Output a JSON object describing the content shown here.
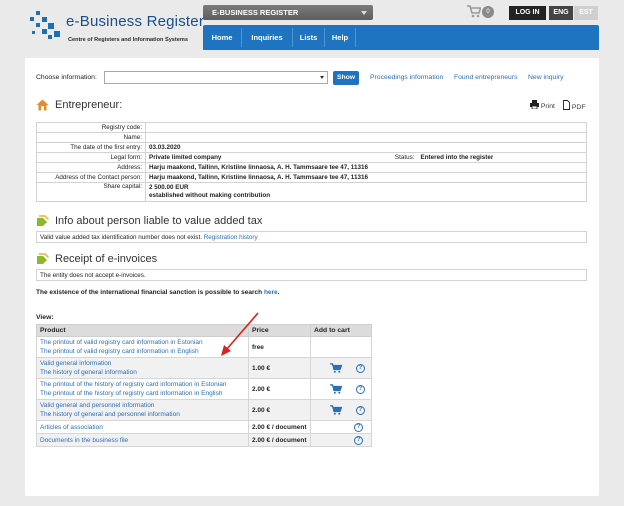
{
  "header": {
    "logo_title": "e-Business Register",
    "logo_subtitle": "Centre of Registers and Information Systems",
    "register_select": "E-BUSINESS REGISTER",
    "cart_count": "0",
    "login_label": "LOG IN",
    "lang_eng": "ENG",
    "lang_est": "EST"
  },
  "nav": [
    "Home",
    "Inquiries",
    "Lists",
    "Help"
  ],
  "search": {
    "choose_label": "Choose information:",
    "select_value": "",
    "show_label": "Show",
    "links": [
      "Proceedings information",
      "Found entrepreneurs",
      "New inquiry"
    ]
  },
  "entrepreneur": {
    "title": "Entrepreneur:",
    "print_label": "Print",
    "pdf_label": "PDF",
    "rows": {
      "registry_code_label": "Registry code:",
      "registry_code": "",
      "name_label": "Name:",
      "name": "",
      "first_entry_label": "The date of the first entry:",
      "first_entry": "03.03.2020",
      "legal_form_label": "Legal form:",
      "legal_form": "Private limited company",
      "status_label": "Status:",
      "status": "Entered into the register",
      "address_label": "Address:",
      "address": "Harju maakond, Tallinn, Kristiine linnaosa, A. H. Tammsaare tee 47, 11316",
      "contact_address_label": "Address of the Contact person:",
      "contact_address": "Harju maakond, Tallinn, Kristiine linnaosa, A. H. Tammsaare tee 47, 11316",
      "share_capital_label": "Share capital:",
      "share_capital": "2 500.00 EUR",
      "share_capital_note": "established without making contribution"
    }
  },
  "vat": {
    "title": "Info about person liable to value added tax",
    "text": "Valid value added tax identification number does not exist.",
    "link": "Registration history"
  },
  "einvoice": {
    "title": "Receipt of e-invoices",
    "text": "The entity does not accept e-invoices."
  },
  "sanction": {
    "text": "The existence of the international financial sanction is possible to search",
    "link": "here",
    "dot": "."
  },
  "view": {
    "label": "View:",
    "headers": [
      "Product",
      "Price",
      "Add to cart"
    ],
    "rows": [
      {
        "items": [
          "The printout of valid registry card information in Estonian",
          "The printout of valid registry card information in English"
        ],
        "price": "free",
        "cart": false,
        "help": false
      },
      {
        "items": [
          "Valid general information",
          "The history of general information"
        ],
        "price": "1.00 €",
        "cart": true,
        "help": true
      },
      {
        "items": [
          "The printout of the history of registry card information in Estonian",
          "The printout of the history of registry card information in English"
        ],
        "price": "2.00 €",
        "cart": true,
        "help": true
      },
      {
        "items": [
          "Valid general and personnel information",
          "The history of general and personnel information"
        ],
        "price": "2.00 €",
        "cart": true,
        "help": true
      },
      {
        "items": [
          "Articles of association"
        ],
        "price": "2.00 € / document",
        "cart": false,
        "help": true
      },
      {
        "items": [
          "Documents in the business file"
        ],
        "price": "2.00 € / document",
        "cart": false,
        "help": true
      }
    ],
    "help_glyph": "?"
  },
  "colors": {
    "nav_blue": "#1f74c2",
    "link_blue": "#2a6fb8",
    "arrow_red": "#d9231e"
  }
}
